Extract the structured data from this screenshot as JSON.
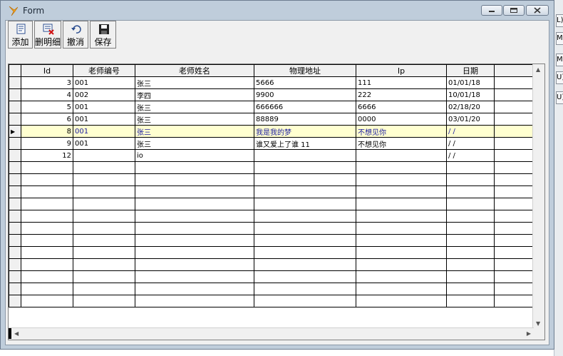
{
  "window": {
    "title": "Form"
  },
  "toolbar": {
    "add_label": "添加",
    "delete_label": "删明细",
    "undo_label": "撤消",
    "save_label": "保存"
  },
  "grid": {
    "columns": [
      "Id",
      "老师编号",
      "老师姓名",
      "物理地址",
      "Ip",
      "日期"
    ],
    "rows": [
      {
        "id": "3",
        "no": "001",
        "name": "张三",
        "addr": "5666",
        "ip": "111",
        "date": "01/01/18"
      },
      {
        "id": "4",
        "no": "002",
        "name": "李四",
        "addr": "9900",
        "ip": "222",
        "date": "10/01/18"
      },
      {
        "id": "5",
        "no": "001",
        "name": "张三",
        "addr": "666666",
        "ip": "6666",
        "date": "02/18/20"
      },
      {
        "id": "6",
        "no": "001",
        "name": "张三",
        "addr": "88889",
        "ip": "0000",
        "date": "03/01/20"
      },
      {
        "id": "8",
        "no": "001",
        "name": "张三",
        "addr": "我是我的梦",
        "ip": "不想见你",
        "date": "/  /"
      },
      {
        "id": "9",
        "no": "001",
        "name": "张三",
        "addr": "谁又爱上了谁 11",
        "ip": "不想见你",
        "date": "/  /"
      },
      {
        "id": "12",
        "no": "",
        "name": "io",
        "addr": "",
        "ip": "",
        "date": "/  /"
      }
    ]
  },
  "right_strip": {
    "tabs": [
      "L)",
      "M)",
      "M)",
      "U)",
      "U)"
    ]
  }
}
